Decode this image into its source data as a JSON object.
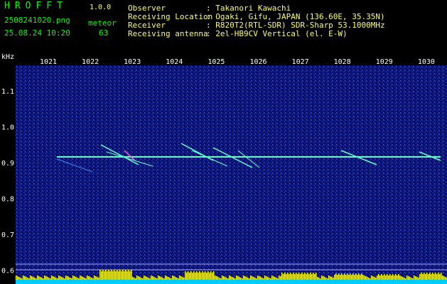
{
  "app": {
    "name": "HROFFT",
    "version": "1.0.0"
  },
  "file": {
    "name": "2508241020.png",
    "datetime": "25.08.24 10:20"
  },
  "detection": {
    "label": "meteor",
    "count": "63"
  },
  "info": {
    "observer_label": "Observer",
    "observer_value": ": Takanori Kawachi",
    "location_label": "Receiving Location",
    "location_value": ": Ogaki, Gifu, JAPAN (136.60E, 35.35N)",
    "receiver_label": "Receiver",
    "receiver_value": ": R820T2(RTL-SDR) SDR-Sharp 53.1000MHz",
    "antenna_label": "Receiving antenna",
    "antenna_value": ": 2el-HB9CV Vertical (el. E-W)"
  },
  "axis": {
    "unit": "kHz",
    "time_ticks": [
      "1021",
      "1022",
      "1023",
      "1024",
      "1025",
      "1026",
      "1027",
      "1028",
      "1029",
      "1030"
    ],
    "freq_ticks": [
      "1.1",
      "1.0",
      "0.9",
      "0.8",
      "0.7",
      "0.6"
    ]
  },
  "colors": {
    "bg": "#000000",
    "label": "#ffffff",
    "header_green": "#00ff00",
    "header_yellow": "#ffff66",
    "signal": "#66ffcc",
    "bars": "#ffff00",
    "base": "#00ccff"
  }
}
